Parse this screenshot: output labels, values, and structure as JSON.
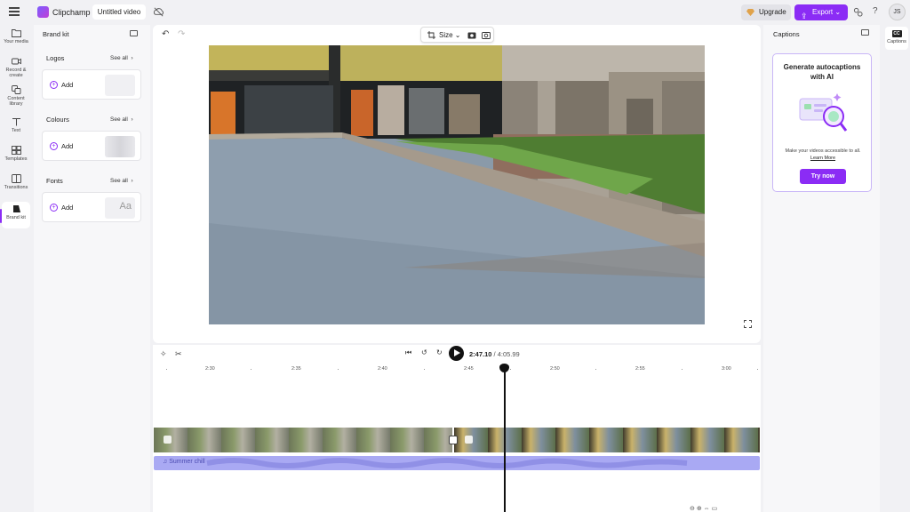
{
  "app": {
    "name": "Clipchamp",
    "project_title": "Untitled video"
  },
  "header": {
    "upgrade_label": "Upgrade",
    "export_label": "Export",
    "avatar_initials": "JS",
    "help_label": "?"
  },
  "leftnav": {
    "items": [
      {
        "label": "Your media",
        "icon": "folder-icon"
      },
      {
        "label": "Record & create",
        "icon": "camera-icon"
      },
      {
        "label": "Content library",
        "icon": "library-icon"
      },
      {
        "label": "Text",
        "icon": "text-icon"
      },
      {
        "label": "Templates",
        "icon": "templates-icon"
      },
      {
        "label": "Transitions",
        "icon": "transitions-icon"
      },
      {
        "label": "Brand kit",
        "icon": "brand-kit-icon",
        "active": true
      }
    ]
  },
  "brandkit": {
    "title": "Brand kit",
    "sections": [
      {
        "label": "Logos",
        "see_all": "See all",
        "add_label": "Add"
      },
      {
        "label": "Colours",
        "see_all": "See all",
        "add_label": "Add"
      },
      {
        "label": "Fonts",
        "see_all": "See all",
        "add_label": "Add",
        "preview": "Aa"
      }
    ]
  },
  "preview": {
    "size_label": "Size"
  },
  "captions": {
    "title": "Captions",
    "card_title": "Generate autocaptions with AI",
    "description": "Make your videos accessible to all.",
    "learn_more": "Learn More",
    "try_now": "Try now",
    "rail_label": "Captions",
    "rail_badge": "CC"
  },
  "timeline": {
    "current_time": "2:47.10",
    "separator": " / ",
    "total_time": "4:05.99",
    "ruler_ticks": [
      "2:30",
      "2:35",
      "2:40",
      "2:45",
      "2:50",
      "2:55",
      "3:00"
    ],
    "audio_clip_label": "Summer chill"
  },
  "colors": {
    "accent": "#8b2cf5",
    "audio_track": "#a9a9f3"
  }
}
